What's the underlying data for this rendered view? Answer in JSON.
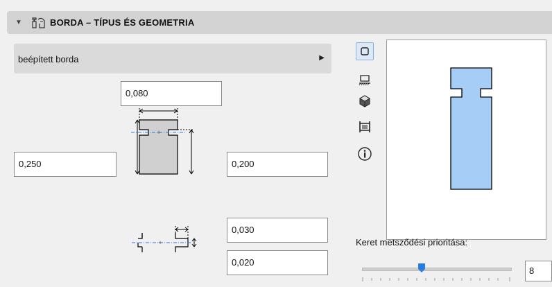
{
  "header": {
    "title": "BORDA – TÍPUS ÉS GEOMETRIA",
    "collapse_icon": "triangle-down-icon",
    "section_icon": "rib-profile-icon"
  },
  "rib_type": {
    "selected": "beépített borda",
    "arrow_icon": "triangle-right-icon"
  },
  "fields": {
    "top_width": "0,080",
    "left_height": "0,250",
    "right_height": "0,200",
    "groove_width": "0,030",
    "groove_depth": "0,020"
  },
  "side_toolbar": [
    {
      "icon": "square-outline-icon",
      "selected": true
    },
    {
      "icon": "floor-plan-symbol-icon",
      "selected": false
    },
    {
      "icon": "3d-cube-icon",
      "selected": false
    },
    {
      "icon": "section-view-icon",
      "selected": false
    },
    {
      "icon": "info-icon",
      "selected": false
    }
  ],
  "priority": {
    "label": "Keret metsződési prioritása:",
    "value": "8",
    "slider_fraction": 0.4
  },
  "colors": {
    "preview_fill": "#a6cdf6",
    "header_bg": "#d3d3d3",
    "accent_blue": "#2a7be0"
  }
}
